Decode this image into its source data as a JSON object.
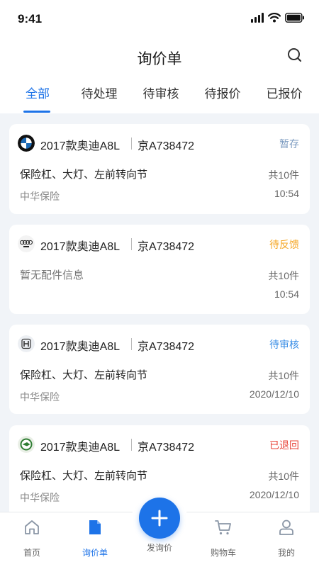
{
  "status_bar": {
    "time": "9:41"
  },
  "header": {
    "title": "询价单",
    "search_icon": "search-icon"
  },
  "tabs": [
    {
      "label": "全部",
      "active": true
    },
    {
      "label": "待处理",
      "active": false
    },
    {
      "label": "待审核",
      "active": false
    },
    {
      "label": "待报价",
      "active": false
    },
    {
      "label": "已报价",
      "active": false
    }
  ],
  "cards": [
    {
      "logo": "bmw-logo",
      "model": "2017款奥迪A8L",
      "plate": "京A738472",
      "status": "暂存",
      "status_color": "#7c9bc0",
      "parts": "保险杠、大灯、左前转向节",
      "count": "共10件",
      "insurer": "中华保险",
      "time": "10:54"
    },
    {
      "logo": "audi-logo",
      "model": "2017款奥迪A8L",
      "plate": "京A738472",
      "status": "待反馈",
      "status_color": "#f5a623",
      "parts": "暂无配件信息",
      "count": "共10件",
      "insurer": "",
      "time": "10:54"
    },
    {
      "logo": "honda-logo",
      "model": "2017款奥迪A8L",
      "plate": "京A738472",
      "status": "待审核",
      "status_color": "#3a8ee6",
      "parts": "保险杠、大灯、左前转向节",
      "count": "共10件",
      "insurer": "中华保险",
      "time": "2020/12/10"
    },
    {
      "logo": "skoda-logo",
      "model": "2017款奥迪A8L",
      "plate": "京A738472",
      "status": "已退回",
      "status_color": "#e8443a",
      "parts": "保险杠、大灯、左前转向节",
      "count": "共10件",
      "insurer": "中华保险",
      "time": "2020/12/10"
    }
  ],
  "tabbar": {
    "items": [
      {
        "label": "首页",
        "icon": "home-icon",
        "active": false
      },
      {
        "label": "询价单",
        "icon": "document-icon",
        "active": true
      },
      {
        "label": "发询价",
        "icon": "plus-icon",
        "active": false
      },
      {
        "label": "购物车",
        "icon": "cart-icon",
        "active": false
      },
      {
        "label": "我的",
        "icon": "user-icon",
        "active": false
      }
    ]
  },
  "colors": {
    "accent": "#1d73e8",
    "background": "#f1f4f8"
  }
}
